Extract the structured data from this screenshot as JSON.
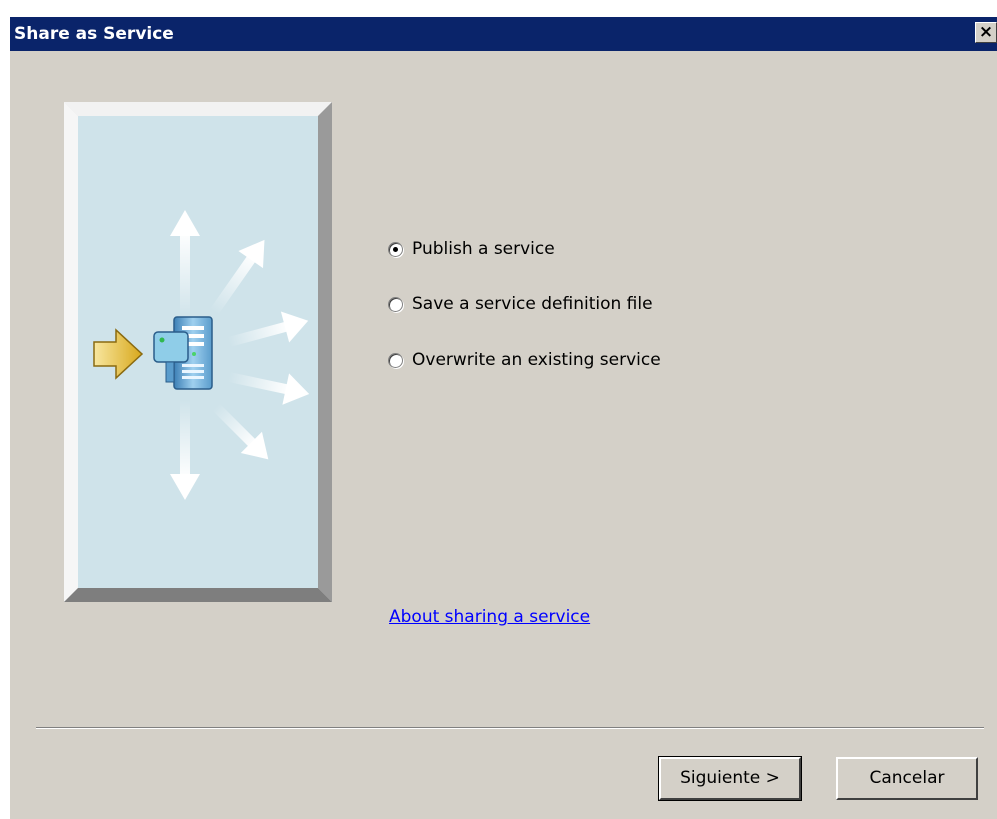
{
  "window": {
    "title": "Share as Service",
    "close_glyph": "✕"
  },
  "options": [
    {
      "label": "Publish a service",
      "checked": true
    },
    {
      "label": "Save a service definition file",
      "checked": false
    },
    {
      "label": "Overwrite an existing service",
      "checked": false
    }
  ],
  "help_link": "About sharing a service",
  "buttons": {
    "next": "Siguiente >",
    "cancel": "Cancelar"
  },
  "colors": {
    "titlebar": "#0a246a",
    "dialog_bg": "#d4d0c8",
    "panel_bg": "#cfe3ea",
    "link": "#0000ff",
    "input_arrow": "#e8c232"
  },
  "icons": {
    "illustration": "server-broadcast-icon"
  }
}
